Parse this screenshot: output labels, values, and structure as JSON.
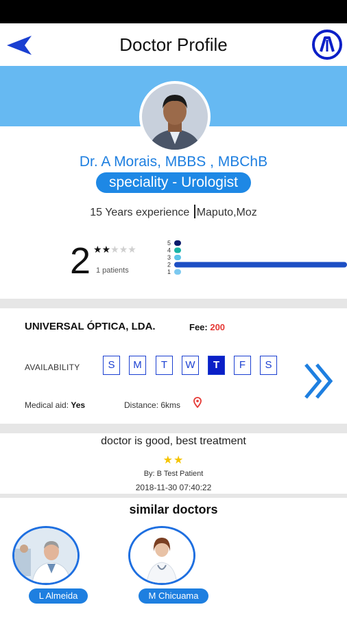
{
  "header": {
    "title": "Doctor Profile"
  },
  "doctor": {
    "name_line": "Dr. A Morais,  MBBS , MBChB",
    "specialty": "speciality - Urologist",
    "experience": "15 Years experience ",
    "location": "Maputo,Moz",
    "rating_value": "2",
    "rating_stars": 2,
    "rating_max": 5,
    "patients": "1 patients"
  },
  "rating_distribution": {
    "levels": [
      "5",
      "4",
      "3",
      "2",
      "1"
    ],
    "counts": [
      0,
      0,
      0,
      1,
      0
    ],
    "colors": [
      "#0b1a6b",
      "#1ab3a6",
      "#5cc4e8",
      "#1d4fc4",
      "#7cc9f0"
    ]
  },
  "clinic": {
    "name": "UNIVERSAL ÓPTICA, LDA.",
    "fee_label": "Fee: ",
    "fee_value": "200",
    "availability_label": "AVAILABILITY",
    "days": [
      "S",
      "M",
      "T",
      "W",
      "T",
      "F",
      "S"
    ],
    "active_day_index": 4,
    "medical_aid_label": "Medical aid: ",
    "medical_aid_value": "Yes",
    "distance": "Distance: 6kms"
  },
  "review": {
    "text": "doctor is good, best treatment",
    "stars": "★★",
    "by": "By: B Test Patient",
    "date": "2018-11-30 07:40:22"
  },
  "similar": {
    "title": "similar doctors",
    "doctors": [
      {
        "name": "L Almeida"
      },
      {
        "name": "M Chicuama"
      }
    ]
  },
  "colors": {
    "banner": "#66b9f2",
    "accent": "#1e7fe0",
    "day_border": "#1a3fd1",
    "fee": "#e53935",
    "star": "#f5c400"
  }
}
